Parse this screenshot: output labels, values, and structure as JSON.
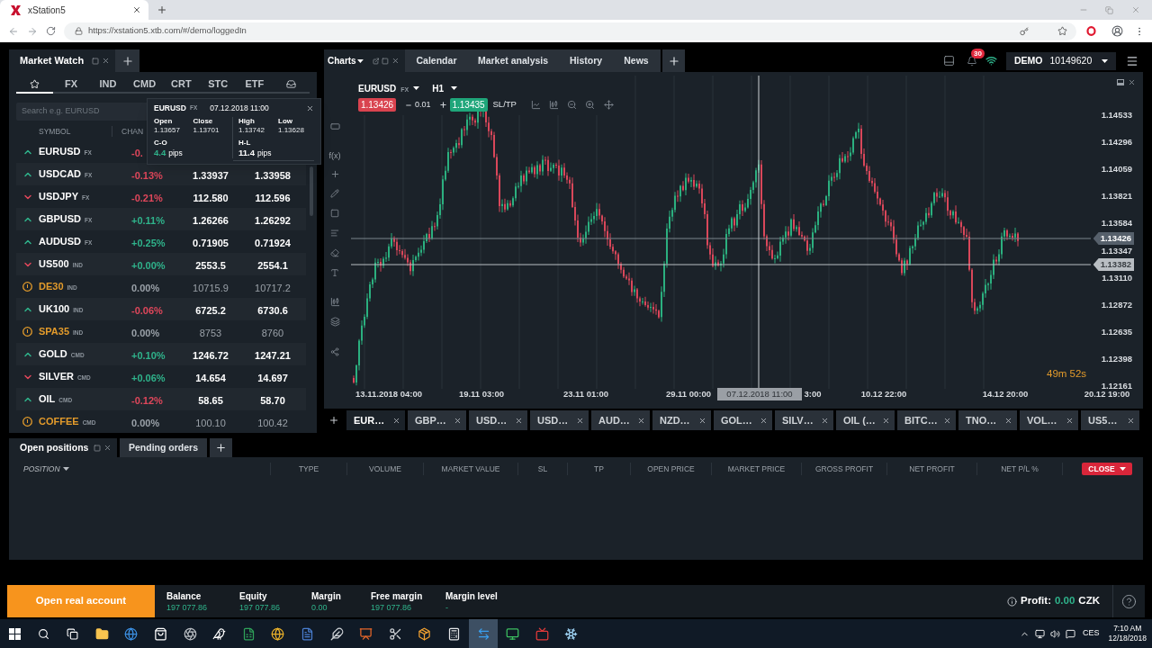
{
  "browser": {
    "tab_title": "xStation5",
    "url": "https://xstation5.xtb.com/#/demo/loggedIn"
  },
  "market_watch": {
    "title": "Market Watch",
    "categories": [
      {
        "kind": "favorites",
        "selected": true
      },
      {
        "kind": "text",
        "label": "FX",
        "selected": false
      },
      {
        "kind": "text",
        "label": "IND",
        "selected": false
      },
      {
        "kind": "text",
        "label": "CMD",
        "selected": false
      },
      {
        "kind": "text",
        "label": "CRT",
        "selected": false
      },
      {
        "kind": "text",
        "label": "STC",
        "selected": false
      },
      {
        "kind": "text",
        "label": "ETF",
        "selected": false
      },
      {
        "kind": "inbox",
        "selected": false
      }
    ],
    "search": {
      "placeholder": "Search e.g. EURUSD"
    },
    "columns": [
      "SYMBOL",
      "CHAN"
    ],
    "rows": [
      {
        "symbol": "EURUSD",
        "type": "FX",
        "kind": "up",
        "change": "-0.",
        "color": "#e0475b"
      },
      {
        "symbol": "USDCAD",
        "type": "FX",
        "kind": "up",
        "change": "-0.13%",
        "color": "#e0475b",
        "sell": "1.33937",
        "buy": "1.33958"
      },
      {
        "symbol": "USDJPY",
        "type": "FX",
        "kind": "down",
        "change": "-0.21%",
        "color": "#e0475b",
        "sell": "112.580",
        "buy": "112.596"
      },
      {
        "symbol": "GBPUSD",
        "type": "FX",
        "kind": "up",
        "change": "+0.11%",
        "color": "#2fb38b",
        "sell": "1.26266",
        "buy": "1.26292"
      },
      {
        "symbol": "AUDUSD",
        "type": "FX",
        "kind": "up",
        "change": "+0.25%",
        "color": "#2fb38b",
        "sell": "0.71905",
        "buy": "0.71924"
      },
      {
        "symbol": "US500",
        "type": "IND",
        "kind": "down",
        "change": "+0.00%",
        "color": "#2fb38b",
        "sell": "2553.5",
        "buy": "2554.1"
      },
      {
        "symbol": "DE30",
        "type": "IND",
        "kind": "closed",
        "change": "0.00%",
        "color": "#9aa1a8",
        "sell": "10715.9",
        "buy": "10717.2"
      },
      {
        "symbol": "UK100",
        "type": "IND",
        "kind": "up",
        "change": "-0.06%",
        "color": "#e0475b",
        "sell": "6725.2",
        "buy": "6730.6"
      },
      {
        "symbol": "SPA35",
        "type": "IND",
        "kind": "closed",
        "change": "0.00%",
        "color": "#9aa1a8",
        "sell": "8753",
        "buy": "8760"
      },
      {
        "symbol": "GOLD",
        "type": "CMD",
        "kind": "up",
        "change": "+0.10%",
        "color": "#2fb38b",
        "sell": "1246.72",
        "buy": "1247.21"
      },
      {
        "symbol": "SILVER",
        "type": "CMD",
        "kind": "down",
        "change": "+0.06%",
        "color": "#2fb38b",
        "sell": "14.654",
        "buy": "14.697"
      },
      {
        "symbol": "OIL",
        "type": "CMD",
        "kind": "up",
        "change": "-0.12%",
        "color": "#e0475b",
        "sell": "58.65",
        "buy": "58.70"
      },
      {
        "symbol": "COFFEE",
        "type": "CMD",
        "kind": "closed",
        "change": "0.00%",
        "color": "#9aa1a8",
        "sell": "100.10",
        "buy": "100.42"
      }
    ]
  },
  "tooltip": {
    "symbol": "EURUSD",
    "type": "FX",
    "time": "07.12.2018 11:00",
    "prices": [
      {
        "label": "Open",
        "value": "1.13657"
      },
      {
        "label": "Close",
        "value": "1.13701"
      },
      {
        "label": "High",
        "value": "1.13742"
      },
      {
        "label": "Low",
        "value": "1.13628"
      }
    ],
    "stats": [
      {
        "label": "C-O",
        "value": "4.4",
        "unit": "pips",
        "color": "#2fb38b"
      },
      {
        "label": "H-L",
        "value": "11.4",
        "unit": "pips",
        "color": "#ffffff"
      }
    ]
  },
  "charts_panel": {
    "title": "Charts",
    "tabs": [
      "Calendar",
      "Market analysis",
      "History",
      "News"
    ]
  },
  "account": {
    "notifications": "30",
    "mode": "DEMO",
    "number": "10149620"
  },
  "chart": {
    "symbol": "EURUSD",
    "type": "FX",
    "interval": "H1",
    "indicator_button": "f(x)",
    "sell": "1.13426",
    "volume": "0.01",
    "buy": "1.13435",
    "sltp": "SL/TP",
    "price_labels": [
      "1.14533",
      "1.14296",
      "1.14059",
      "1.13821",
      "1.13584",
      "1.13347",
      "1.13110",
      "1.12872",
      "1.12635",
      "1.12398",
      "1.12161"
    ],
    "price_tags": [
      {
        "kind": "bid",
        "value": "1.13426"
      },
      {
        "kind": "cursor",
        "value": "1.13382"
      }
    ],
    "time_labels": [
      "13.11.2018 04:00",
      "19.11 03:00",
      "23.11 01:00",
      "29.11 00:00",
      "3:00",
      "10.12 22:00",
      "14.12 20:00",
      "20.12 19:00"
    ],
    "time_tag": "07.12.2018 11:00",
    "countdown": "49m 52s"
  },
  "chart_tabs": [
    {
      "label": "EUR…",
      "selected": true
    },
    {
      "label": "GBP…",
      "selected": false
    },
    {
      "label": "USD…",
      "selected": false
    },
    {
      "label": "USD…",
      "selected": false
    },
    {
      "label": "AUD…",
      "selected": false
    },
    {
      "label": "NZD…",
      "selected": false
    },
    {
      "label": "GOL…",
      "selected": false
    },
    {
      "label": "SILV…",
      "selected": false
    },
    {
      "label": "OIL (…",
      "selected": false
    },
    {
      "label": "BITC…",
      "selected": false
    },
    {
      "label": "TNO…",
      "selected": false
    },
    {
      "label": "VOL…",
      "selected": false
    },
    {
      "label": "US5…",
      "selected": false
    }
  ],
  "positions": {
    "tabs": [
      {
        "label": "Open positions",
        "selected": true
      },
      {
        "label": "Pending orders",
        "selected": false
      }
    ],
    "columns": [
      {
        "label": "POSITION",
        "sorted": true
      },
      {
        "label": "TYPE",
        "sorted": false
      },
      {
        "label": "VOLUME",
        "sorted": false
      },
      {
        "label": "MARKET VALUE",
        "sorted": false
      },
      {
        "label": "SL",
        "sorted": false
      },
      {
        "label": "TP",
        "sorted": false
      },
      {
        "label": "OPEN PRICE",
        "sorted": false
      },
      {
        "label": "MARKET PRICE",
        "sorted": false
      },
      {
        "label": "GROSS PROFIT",
        "sorted": false
      },
      {
        "label": "NET PROFIT",
        "sorted": false
      },
      {
        "label": "NET P/L %",
        "sorted": false
      }
    ],
    "close_button": "CLOSE"
  },
  "status_bar": {
    "open_account": "Open real account",
    "stats": [
      {
        "label": "Balance",
        "value": "197 077.86"
      },
      {
        "label": "Equity",
        "value": "197 077.86"
      },
      {
        "label": "Margin",
        "value": "0.00"
      },
      {
        "label": "Free margin",
        "value": "197 077.86"
      },
      {
        "label": "Margin level",
        "value": "-"
      }
    ],
    "profit_label": "Profit:",
    "profit_value": "0.00",
    "currency": "CZK"
  },
  "taskbar": {
    "apps": [
      {
        "kind": "folder",
        "selected": false
      },
      {
        "kind": "browser",
        "selected": false
      },
      {
        "kind": "store",
        "selected": false
      },
      {
        "kind": "aperture",
        "selected": false
      },
      {
        "kind": "bird",
        "selected": false
      },
      {
        "kind": "spreadsheet",
        "selected": false
      },
      {
        "kind": "globe",
        "selected": false
      },
      {
        "kind": "document",
        "selected": false
      },
      {
        "kind": "feather",
        "selected": false
      },
      {
        "kind": "presentation",
        "selected": false
      },
      {
        "kind": "scissors",
        "selected": false
      },
      {
        "kind": "package",
        "selected": false
      },
      {
        "kind": "calculator",
        "selected": false
      },
      {
        "kind": "remote",
        "selected": true
      },
      {
        "kind": "monitor",
        "selected": false
      },
      {
        "kind": "video",
        "selected": false
      },
      {
        "kind": "snowflake",
        "selected": false
      }
    ],
    "language": "CES",
    "time": "7:10 AM",
    "date": "12/18/2018"
  }
}
